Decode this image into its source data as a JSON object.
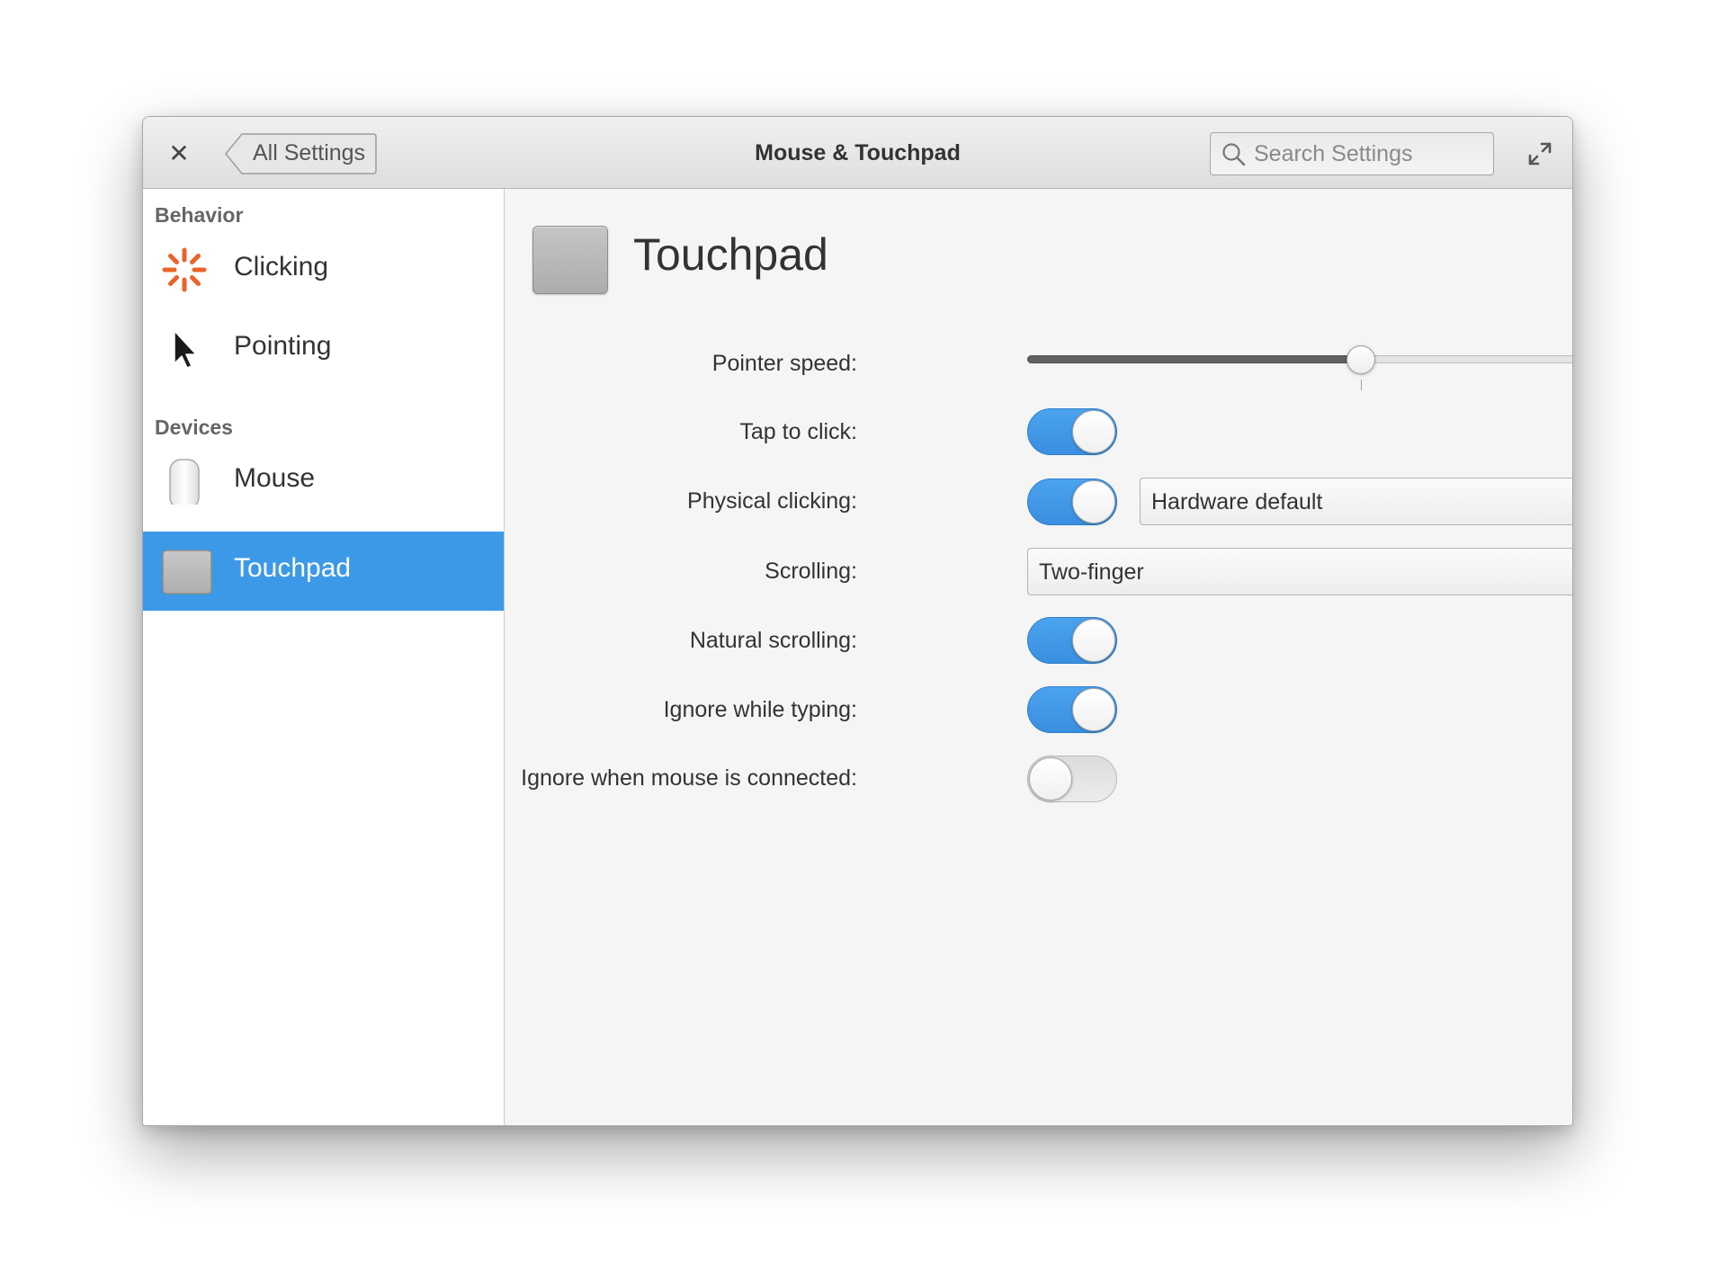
{
  "window": {
    "title": "Mouse & Touchpad"
  },
  "header": {
    "back_label": "All Settings",
    "search": {
      "placeholder": "Search Settings",
      "value": ""
    }
  },
  "sidebar": {
    "sections": [
      {
        "header": "Behavior",
        "items": [
          {
            "label": "Clicking",
            "icon": "clicking-icon"
          },
          {
            "label": "Pointing",
            "icon": "pointer-icon"
          }
        ]
      },
      {
        "header": "Devices",
        "items": [
          {
            "label": "Mouse",
            "icon": "mouse-icon"
          },
          {
            "label": "Touchpad",
            "icon": "touchpad-icon",
            "selected": true
          }
        ]
      }
    ]
  },
  "page": {
    "title": "Touchpad",
    "pointer_speed": {
      "label": "Pointer speed:",
      "value": 0.5
    },
    "tap_to_click": {
      "label": "Tap to click:",
      "on": true
    },
    "physical_clicking": {
      "label": "Physical clicking:",
      "on": true,
      "selected": "Hardware default"
    },
    "scrolling": {
      "label": "Scrolling:",
      "selected": "Two-finger"
    },
    "natural_scrolling": {
      "label": "Natural scrolling:",
      "on": true
    },
    "ignore_typing": {
      "label": "Ignore while typing:",
      "on": true
    },
    "ignore_mouse": {
      "label": "Ignore when mouse is connected:",
      "on": false
    }
  },
  "colors": {
    "accent": "#3c99e8",
    "clicking_icon": "#e8642a"
  }
}
